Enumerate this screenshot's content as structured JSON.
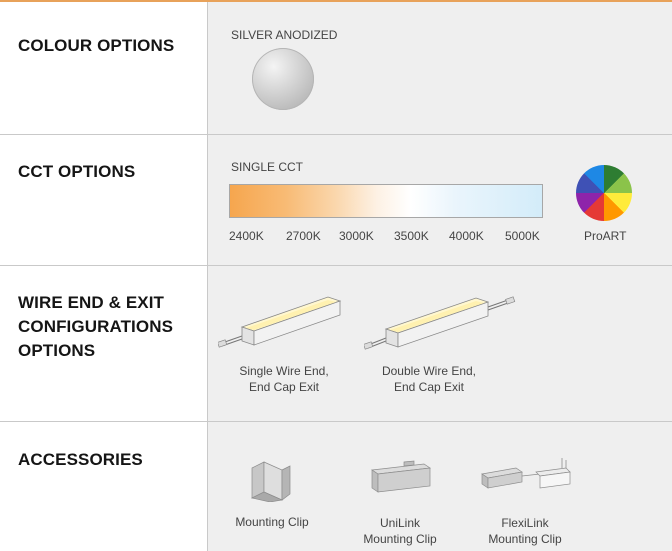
{
  "sections": {
    "colour": {
      "heading": "COLOUR OPTIONS",
      "option_label": "SILVER ANODIZED"
    },
    "cct": {
      "heading": "CCT OPTIONS",
      "subheading": "SINGLE CCT",
      "temperatures": [
        "2400K",
        "2700K",
        "3000K",
        "3500K",
        "4000K",
        "5000K"
      ],
      "proart_label": "ProART"
    },
    "wire": {
      "heading_lines": [
        "WIRE END & EXIT",
        "CONFIGURATIONS",
        "OPTIONS"
      ],
      "items": [
        {
          "line1": "Single Wire End,",
          "line2": "End Cap Exit"
        },
        {
          "line1": "Double Wire End,",
          "line2": "End Cap Exit"
        }
      ]
    },
    "accessories": {
      "heading": "ACCESSORIES",
      "items": [
        {
          "line1": "Mounting Clip",
          "line2": ""
        },
        {
          "line1": "UniLink",
          "line2": "Mounting Clip"
        },
        {
          "line1": "FlexiLink",
          "line2": "Mounting Clip"
        }
      ]
    }
  },
  "colors": {
    "accent_line": "#e8a25a",
    "row_background": "#efefef",
    "divider": "#c9c9c9"
  }
}
